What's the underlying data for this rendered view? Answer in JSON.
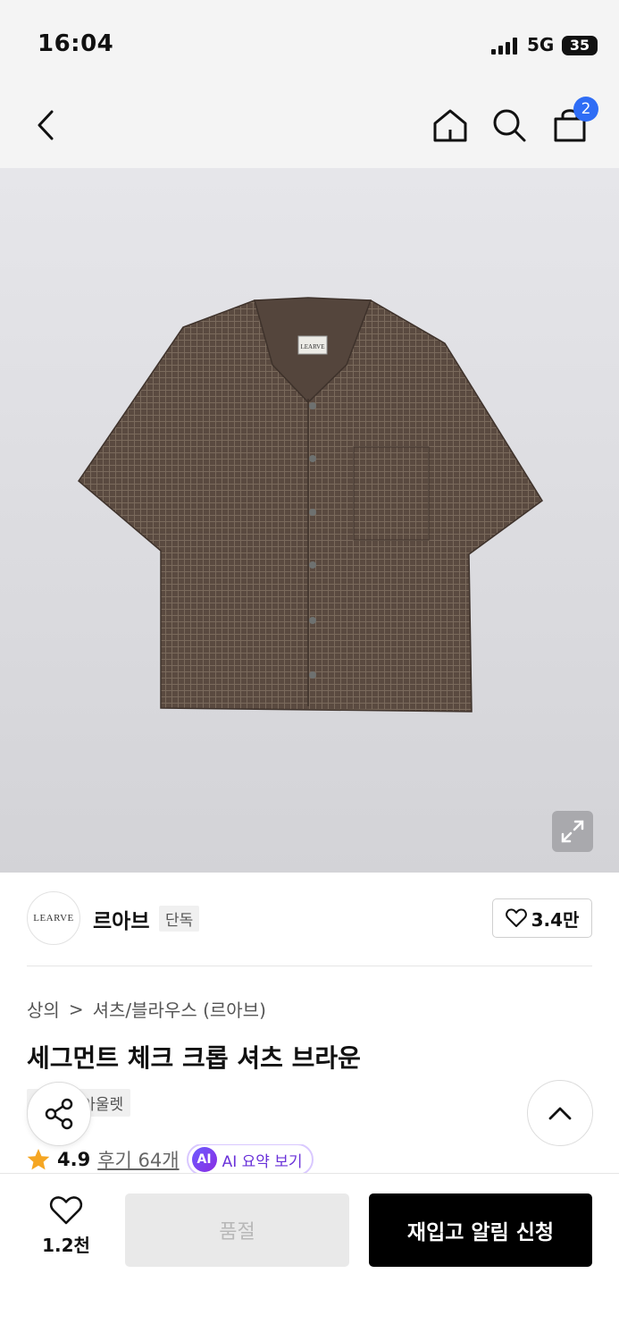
{
  "status_bar": {
    "time": "16:04",
    "network": "5G",
    "battery": "35"
  },
  "nav": {
    "cart_count": "2"
  },
  "brand": {
    "logo_text": "LEARVE",
    "name": "르아브",
    "exclusive_label": "단독",
    "like_count": "3.4만"
  },
  "breadcrumb": {
    "category": "상의",
    "separator": ">",
    "subcategory": "셔츠/블라우스 (르아브)"
  },
  "product": {
    "title": "세그먼트 체크 크롭 셔츠 브라운",
    "tags": [
      "단독",
      "아울렛"
    ],
    "rating": "4.9",
    "reviews": "후기 64개",
    "ai_badge": "AI",
    "ai_summary": "AI 요약 보기",
    "shirt_label": "LEARVE"
  },
  "bottom": {
    "wish_count": "1.2천",
    "soldout_label": "품절",
    "restock_label": "재입고 알림 신청"
  },
  "colors": {
    "accent_blue": "#2f6df5",
    "star": "#f5a623",
    "ai_purple": "#6a32d9",
    "shirt": "#5a4a40"
  }
}
